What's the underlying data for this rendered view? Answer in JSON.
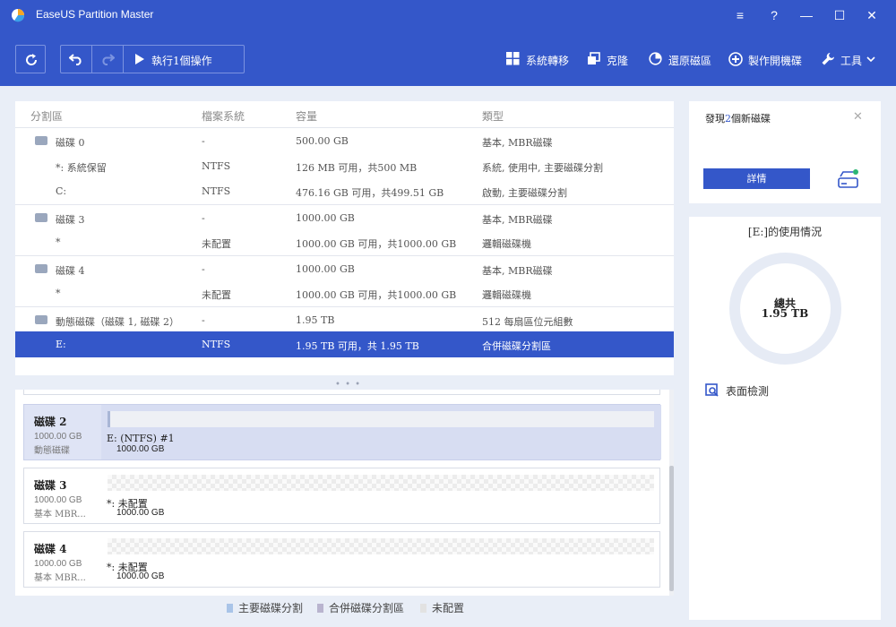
{
  "window": {
    "title": "EaseUS Partition Master",
    "controls": [
      "≡",
      "?",
      "—",
      "☐",
      "✕"
    ]
  },
  "toolbar": {
    "execute_label": "執行1個操作",
    "actions": [
      {
        "label": "系統轉移",
        "icon": "windows-icon"
      },
      {
        "label": "克隆",
        "icon": "clone-icon"
      },
      {
        "label": "還原磁區",
        "icon": "pie-icon"
      },
      {
        "label": "製作開機碟",
        "icon": "plus-circle-icon"
      },
      {
        "label": "工具",
        "icon": "wrench-icon"
      }
    ]
  },
  "table": {
    "headers": [
      "分割區",
      "檔案系統",
      "容量",
      "類型"
    ],
    "rows": [
      {
        "name": "磁碟 0",
        "fs": "-",
        "capacity": "500.00 GB",
        "type": "基本, MBR磁碟",
        "disk": true
      },
      {
        "name": "*: 系統保留",
        "fs": "NTFS",
        "capacity": "126 MB 可用，共500 MB",
        "type": "系統, 使用中, 主要磁碟分割",
        "disk": false
      },
      {
        "name": "C:",
        "fs": "NTFS",
        "capacity": "476.16 GB 可用，共499.51 GB",
        "type": "啟動, 主要磁碟分割",
        "disk": false
      },
      {
        "name": "磁碟 3",
        "fs": "-",
        "capacity": "1000.00 GB",
        "type": "基本, MBR磁碟",
        "disk": true
      },
      {
        "name": "*",
        "fs": "未配置",
        "capacity": "1000.00 GB 可用，共1000.00 GB",
        "type": "邏輯磁碟機",
        "disk": false
      },
      {
        "name": "磁碟 4",
        "fs": "-",
        "capacity": "1000.00 GB",
        "type": "基本, MBR磁碟",
        "disk": true
      },
      {
        "name": "*",
        "fs": "未配置",
        "capacity": "1000.00 GB 可用，共1000.00 GB",
        "type": "邏輯磁碟機",
        "disk": false
      },
      {
        "name": "動態磁碟（磁碟 1, 磁碟 2）",
        "fs": "-",
        "capacity": "1.95 TB",
        "type": "512 每扇區位元組數",
        "disk": true
      },
      {
        "name": "E:",
        "fs": "NTFS",
        "capacity": "1.95 TB 可用，共 1.95 TB",
        "type": "合併磁碟分割區",
        "disk": false,
        "selected": true
      }
    ]
  },
  "disk_map": [
    {
      "title": "磁碟 2",
      "size": "1000.00 GB",
      "type": "動態磁碟",
      "part_label": "E: (NTFS) #1",
      "part_size": "1000.00 GB",
      "kind": "plain",
      "selected": true
    },
    {
      "title": "磁碟 3",
      "size": "1000.00 GB",
      "type": "基本 MBR...",
      "part_label": "*: 未配置",
      "part_size": "1000.00 GB",
      "kind": "hatch",
      "selected": false
    },
    {
      "title": "磁碟 4",
      "size": "1000.00 GB",
      "type": "基本 MBR...",
      "part_label": "*: 未配置",
      "part_size": "1000.00 GB",
      "kind": "hatch",
      "selected": false
    }
  ],
  "legend": [
    {
      "label": "主要磁碟分割",
      "color": "#a9c4e8"
    },
    {
      "label": "合併磁碟分割區",
      "color": "#b9b4cf"
    },
    {
      "label": "未配置",
      "color": "#e2e2e2"
    }
  ],
  "side": {
    "found_prefix": "發現",
    "found_count": "2",
    "found_suffix": "個新磁碟",
    "close": "✕",
    "details_label": "詳情",
    "usage_title": "[E:]的使用情況",
    "total_label": "總共",
    "total_value": "1.95 TB",
    "surface_test": "表面檢測"
  },
  "colors": {
    "accent": "#3457c9",
    "background": "#e9eef7"
  }
}
